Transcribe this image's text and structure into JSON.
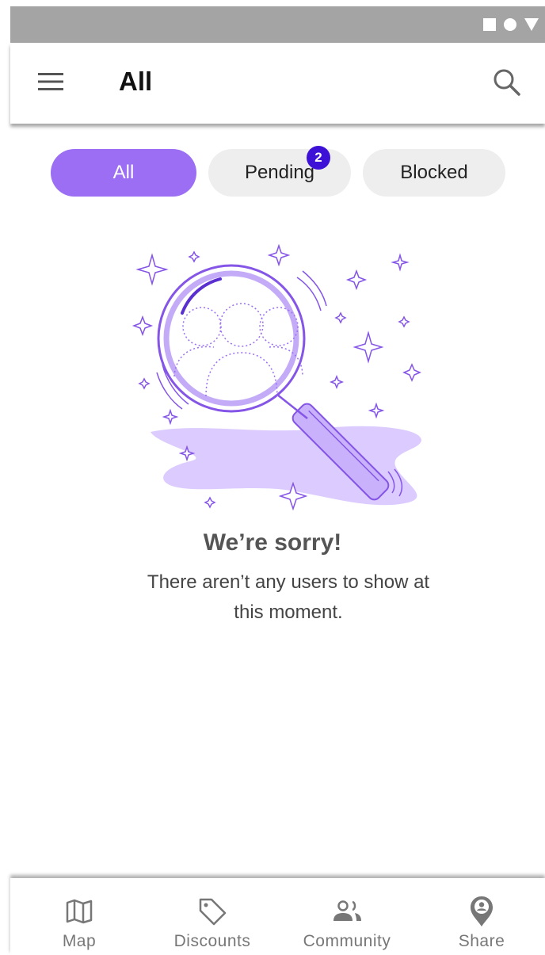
{
  "status_bar": {
    "icons": [
      "square-icon",
      "circle-icon",
      "triangle-icon"
    ]
  },
  "app_bar": {
    "title": "All",
    "menu_icon": "hamburger-menu-icon",
    "search_icon": "search-icon"
  },
  "tabs": [
    {
      "label": "All",
      "active": true
    },
    {
      "label": "Pending",
      "active": false,
      "badge": "2"
    },
    {
      "label": "Blocked",
      "active": false
    }
  ],
  "empty_state": {
    "title": "We’re sorry!",
    "message": "There aren’t any users to show at this moment."
  },
  "bottom_nav": [
    {
      "label": "Map",
      "icon": "map-icon"
    },
    {
      "label": "Discounts",
      "icon": "tag-icon"
    },
    {
      "label": "Community",
      "icon": "people-icon"
    },
    {
      "label": "Share",
      "icon": "location-pin-icon"
    }
  ],
  "colors": {
    "accent": "#9b6ef3",
    "badge": "#3d12d6",
    "status_bar": "#a4a4a4"
  }
}
